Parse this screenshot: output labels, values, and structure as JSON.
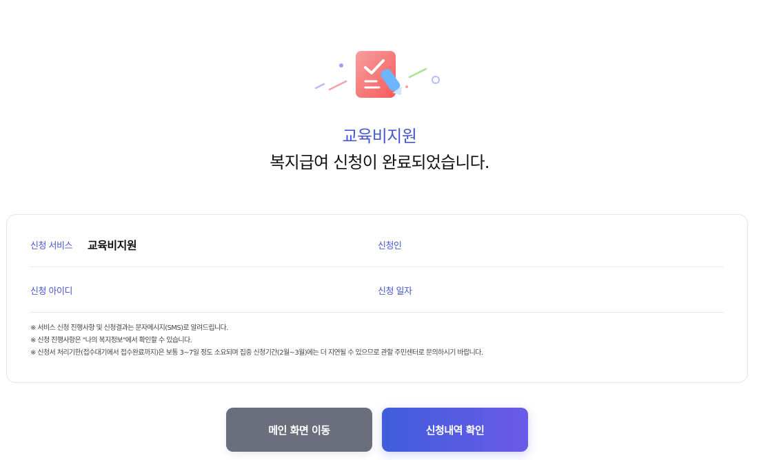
{
  "header": {
    "service_title": "교육비지원",
    "complete_message": "복지급여 신청이 완료되었습니다."
  },
  "info": {
    "service_label": "신청 서비스",
    "service_value": "교육비지원",
    "applicant_label": "신청인",
    "applicant_value": "",
    "user_id_label": "신청 아이디",
    "user_id_value": "",
    "date_label": "신청 일자",
    "date_value": ""
  },
  "notes": [
    "※ 서비스 신청 진행사항 및 신청결과는 문자메시지(SMS)로 알려드립니다.",
    "※ 신청 진행사항은 \"나의 복지정보\"에서 확인할 수 있습니다.",
    "※ 신청서 처리기한(접수대기에서 접수완료까지)은 보통 3~7일 정도 소요되며 집중 신청기간(2월~3월)에는 더 지연될 수 있으므로 관할 주민센터로 문의하시기 바랍니다."
  ],
  "buttons": {
    "main_label": "메인 화면 이동",
    "history_label": "신청내역 확인"
  },
  "colors": {
    "accent": "#4856d3",
    "button_gray": "#6b6e7d",
    "button_gradient_start": "#3f5ddc",
    "button_gradient_end": "#6b5ae8",
    "icon_red": "#f06a6a",
    "icon_blue": "#6cb6ff"
  },
  "icons": {
    "hero": "application-complete-clipboard-icon"
  }
}
